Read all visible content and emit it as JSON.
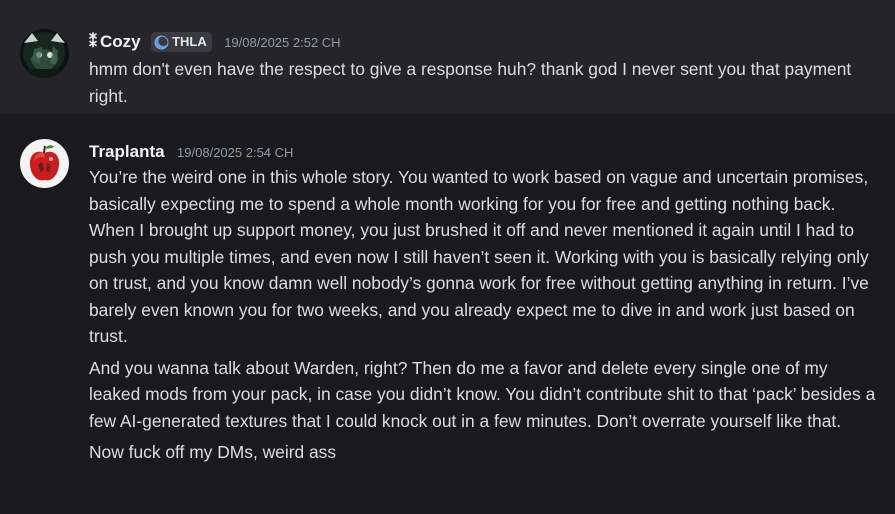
{
  "messages": [
    {
      "author_glyph": "⁑",
      "author": "Cozy",
      "tag": "THLA",
      "timestamp": "19/08/2025 2:52 CH",
      "paragraphs": [
        "hmm don't even have the respect to give a response huh? thank god I never sent you that payment right."
      ]
    },
    {
      "author": "Traplanta",
      "timestamp": "19/08/2025 2:54 CH",
      "paragraphs": [
        "You’re the weird one in this whole story. You wanted to work based on vague and uncertain promises, basically expecting me to spend a whole month working for you for free and getting nothing back. When I brought up support money, you just brushed it off and never mentioned it again until I had to push you multiple times, and even now I still haven’t seen it. Working with you is basically relying only on trust, and you know damn well nobody’s gonna work for free without getting anything in return. I’ve barely even known you for two weeks, and you already expect me to dive in and work just based on trust.",
        "And you wanna talk about Warden, right? Then do me a favor and delete every single one of my leaked mods from your pack, in case you didn’t know. You didn’t contribute shit to that ‘pack’ besides a few AI-generated textures that I could knock out in a few minutes. Don’t overrate yourself like that.",
        "Now fuck off my DMs, weird ass"
      ]
    }
  ],
  "colors": {
    "background": "#1a1a1e",
    "highlighted_message_bg": "#242429",
    "username": "#f2f3f5",
    "message_text": "#dbdee1",
    "timestamp": "#949ba4",
    "tag_bg": "#3a3b42",
    "tag_icon": "#5b9bf0"
  },
  "icons": {
    "avatar_cozy": "dark-green-character-avatar",
    "tag_icon": "blue-crescent-icon",
    "avatar_traplanta": "red-apple-avatar"
  }
}
